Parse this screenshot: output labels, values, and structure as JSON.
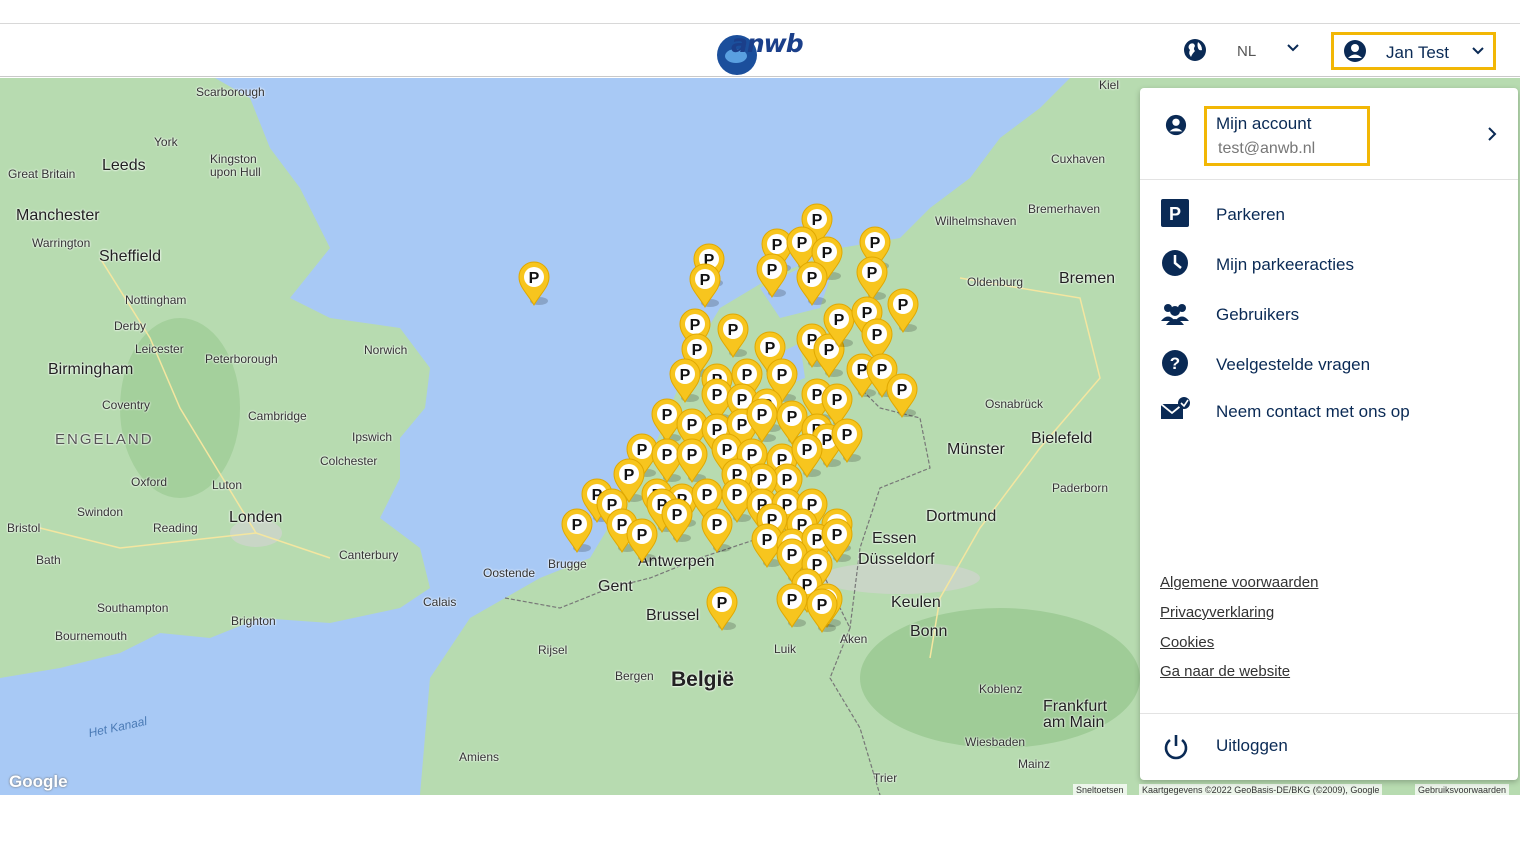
{
  "header": {
    "logo_text": "anwb",
    "language": "NL",
    "user_name": "Jan Test"
  },
  "map": {
    "places": [
      {
        "label": "Scarborough",
        "kind": "place"
      },
      {
        "label": "York",
        "kind": "place"
      },
      {
        "label": "Leeds",
        "kind": "big"
      },
      {
        "label": "Kingston upon Hull",
        "kind": "place"
      },
      {
        "label": "Great Britain",
        "kind": "place"
      },
      {
        "label": "Manchester",
        "kind": "big"
      },
      {
        "label": "Warrington",
        "kind": "place"
      },
      {
        "label": "Sheffield",
        "kind": "big"
      },
      {
        "label": "Nottingham",
        "kind": "place"
      },
      {
        "label": "Derby",
        "kind": "place"
      },
      {
        "label": "Leicester",
        "kind": "place"
      },
      {
        "label": "Peterborough",
        "kind": "place"
      },
      {
        "label": "Norwich",
        "kind": "place"
      },
      {
        "label": "Birmingham",
        "kind": "big"
      },
      {
        "label": "Coventry",
        "kind": "place"
      },
      {
        "label": "ENGELAND",
        "kind": "country"
      },
      {
        "label": "Cambridge",
        "kind": "place"
      },
      {
        "label": "Ipswich",
        "kind": "place"
      },
      {
        "label": "Colchester",
        "kind": "place"
      },
      {
        "label": "Oxford",
        "kind": "place"
      },
      {
        "label": "Luton",
        "kind": "place"
      },
      {
        "label": "Swindon",
        "kind": "place"
      },
      {
        "label": "Reading",
        "kind": "place"
      },
      {
        "label": "Londen",
        "kind": "big"
      },
      {
        "label": "Bristol",
        "kind": "place"
      },
      {
        "label": "Bath",
        "kind": "place"
      },
      {
        "label": "Canterbury",
        "kind": "place"
      },
      {
        "label": "Southampton",
        "kind": "place"
      },
      {
        "label": "Brighton",
        "kind": "place"
      },
      {
        "label": "Bournemouth",
        "kind": "place"
      },
      {
        "label": "Het Kanaal",
        "kind": "water"
      },
      {
        "label": "Calais",
        "kind": "place"
      },
      {
        "label": "Oostende",
        "kind": "place"
      },
      {
        "label": "Brugge",
        "kind": "place"
      },
      {
        "label": "Gent",
        "kind": "place"
      },
      {
        "label": "Antwerpen",
        "kind": "big"
      },
      {
        "label": "Brussel",
        "kind": "big"
      },
      {
        "label": "Rijsel",
        "kind": "place"
      },
      {
        "label": "Bergen",
        "kind": "place"
      },
      {
        "label": "België",
        "kind": "country2"
      },
      {
        "label": "Luik",
        "kind": "place"
      },
      {
        "label": "Aken",
        "kind": "place"
      },
      {
        "label": "Amiens",
        "kind": "place"
      },
      {
        "label": "Trier",
        "kind": "place"
      },
      {
        "label": "Wilhelmshaven",
        "kind": "place"
      },
      {
        "label": "Bremerhaven",
        "kind": "place"
      },
      {
        "label": "Cuxhaven",
        "kind": "place"
      },
      {
        "label": "Kiel",
        "kind": "place"
      },
      {
        "label": "Oldenburg",
        "kind": "place"
      },
      {
        "label": "Bremen",
        "kind": "big"
      },
      {
        "label": "Osnabrück",
        "kind": "place"
      },
      {
        "label": "Bielefeld",
        "kind": "big"
      },
      {
        "label": "Münster",
        "kind": "big"
      },
      {
        "label": "Paderborn",
        "kind": "place"
      },
      {
        "label": "Dortmund",
        "kind": "big"
      },
      {
        "label": "Essen",
        "kind": "big"
      },
      {
        "label": "Düsseldorf",
        "kind": "big"
      },
      {
        "label": "Keulen",
        "kind": "big"
      },
      {
        "label": "Bonn",
        "kind": "big"
      },
      {
        "label": "Koblenz",
        "kind": "place"
      },
      {
        "label": "Frankfurt am Main",
        "kind": "big"
      },
      {
        "label": "Wiesbaden",
        "kind": "place"
      },
      {
        "label": "Mainz",
        "kind": "place"
      }
    ],
    "pin_letter": "P",
    "google_label": "Google",
    "attribution": [
      "Sneltoetsen",
      "Kaartgegevens ©2022 GeoBasis-DE/BKG (©2009), Google",
      "Gebruiksvoorwaarden"
    ]
  },
  "panel": {
    "account_title": "Mijn account",
    "account_email": "test@anwb.nl",
    "menu": [
      {
        "label": "Parkeren",
        "icon": "parking-icon"
      },
      {
        "label": "Mijn parkeeracties",
        "icon": "clock-icon"
      },
      {
        "label": "Gebruikers",
        "icon": "users-icon"
      },
      {
        "label": "Veelgestelde vragen",
        "icon": "question-icon"
      },
      {
        "label": "Neem contact met ons op",
        "icon": "mail-icon"
      }
    ],
    "links": [
      "Algemene voorwaarden",
      "Privacyverklaring",
      "Cookies",
      "Ga naar de website"
    ],
    "logout_label": "Uitloggen"
  },
  "colors": {
    "accent_yellow": "#f2b705",
    "navy": "#0a2a55",
    "water": "#a8c9f5",
    "land": "#b7dbb0"
  }
}
